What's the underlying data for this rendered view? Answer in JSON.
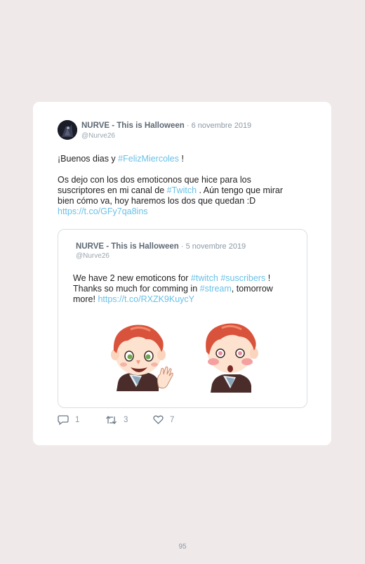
{
  "tweet": {
    "author_name": "NURVE - This is Halloween",
    "date": "6 novembre 2019",
    "handle": "@Nurve26",
    "line1": {
      "pre": "¡Buenos dias y ",
      "hashtag": "#FelizMiercoles",
      "post": " !"
    },
    "para2": {
      "pre": "Os dejo con los dos emoticonos que hice para los suscriptores en mi canal de ",
      "hashtag": "#Twitch",
      "post": " . Aún tengo que mirar bien cómo va, hoy haremos los dos que quedan :D",
      "link": "https://t.co/GFy7qa8ins"
    }
  },
  "quoted": {
    "author_name": "NURVE - This is Halloween",
    "date": "5 novembre 2019",
    "handle": "@Nurve26",
    "t1": "We have 2 new emoticons for ",
    "tag1": "#twitch",
    "tag2": "#suscribers",
    "t2": " !",
    "t3": "Thanks so much for comming in ",
    "tag3": "#stream",
    "t4": ", tomorrow more! ",
    "link": "https://t.co/RXZK9KuycY"
  },
  "actions": {
    "replies": "1",
    "retweets": "3",
    "likes": "7"
  },
  "page_number": "95",
  "colors": {
    "background": "#efe9e9",
    "link": "#69c1e8",
    "hair": "#d9533c"
  }
}
